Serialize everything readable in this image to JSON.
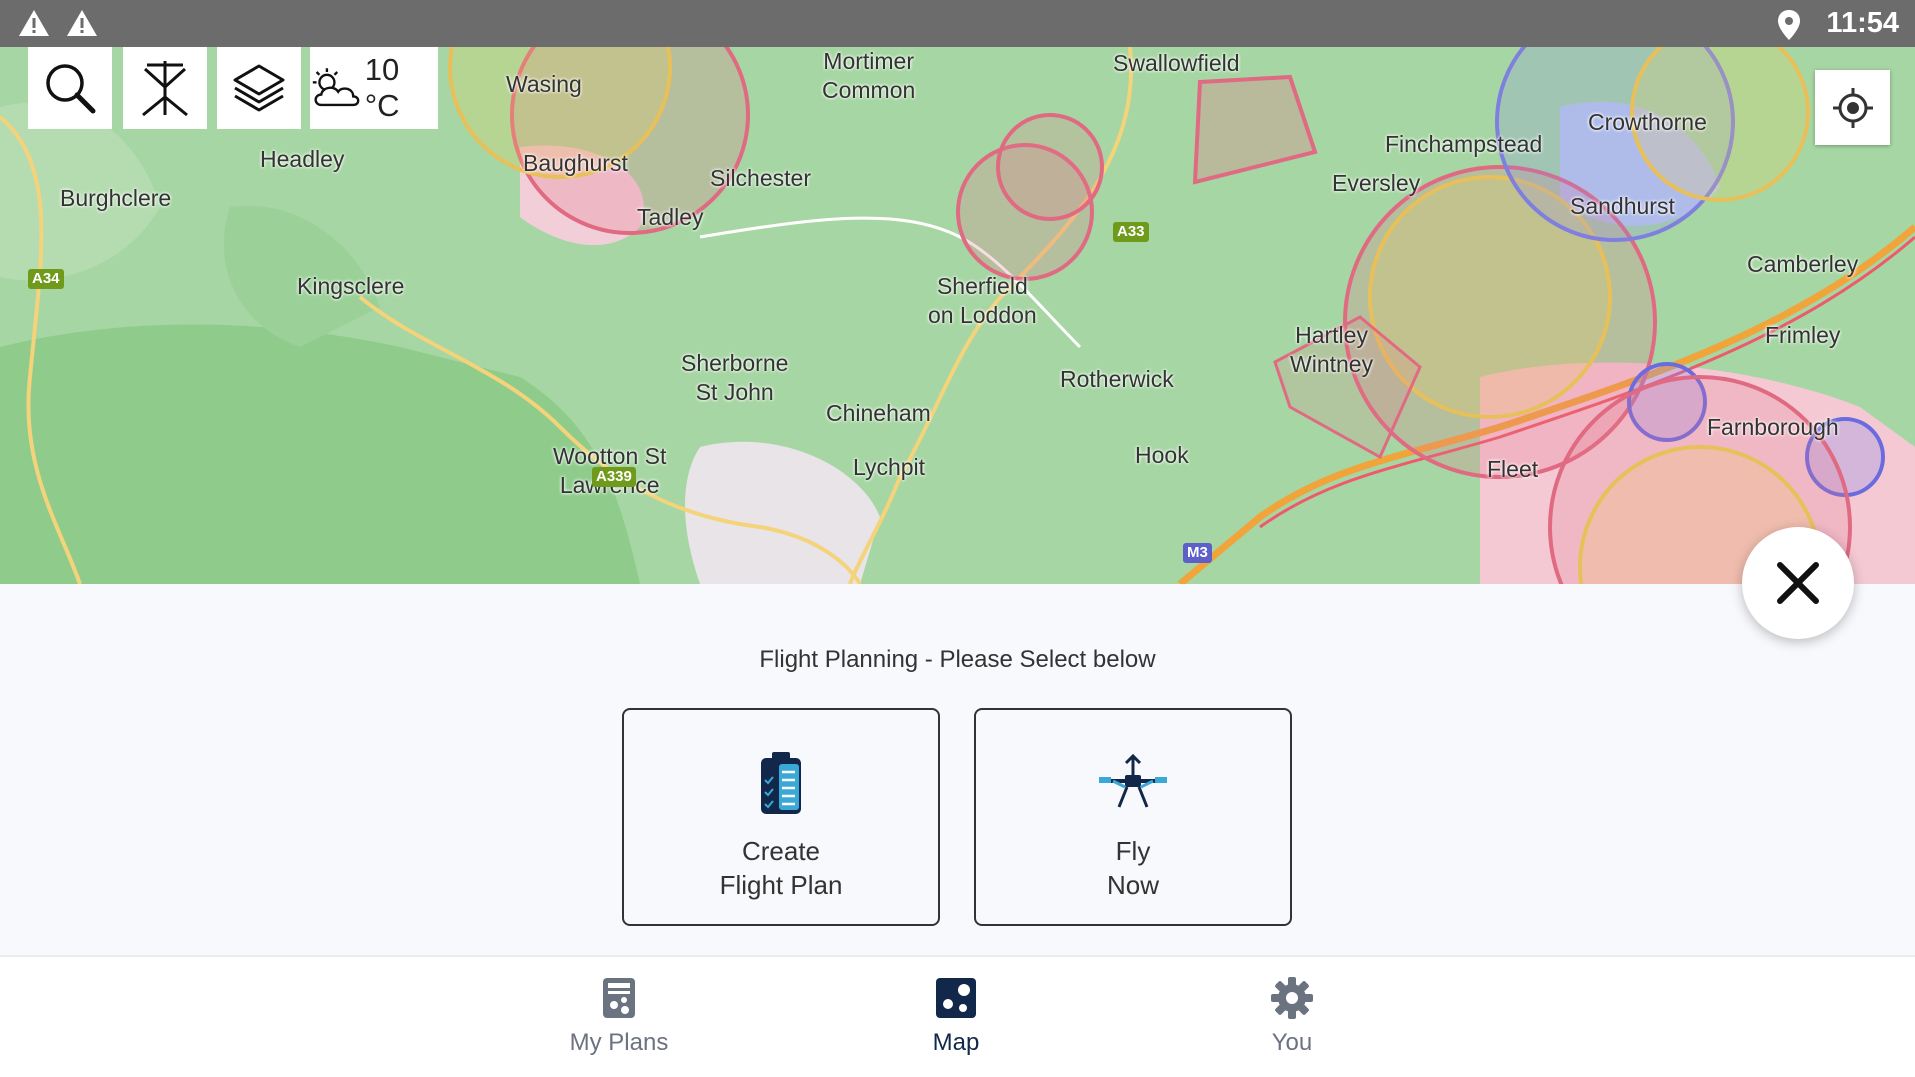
{
  "status_bar": {
    "time": "11:54"
  },
  "toolbar": {
    "temperature": "10 °C"
  },
  "map": {
    "places": [
      {
        "name": "Wasing"
      },
      {
        "name": "Mortimer\nCommon"
      },
      {
        "name": "Swallowfield"
      },
      {
        "name": "Headley"
      },
      {
        "name": "Baughurst"
      },
      {
        "name": "Silchester"
      },
      {
        "name": "Finchampstead"
      },
      {
        "name": "Crowthorne"
      },
      {
        "name": "Burghclere"
      },
      {
        "name": "Tadley"
      },
      {
        "name": "Eversley"
      },
      {
        "name": "Sandhurst"
      },
      {
        "name": "Camberley"
      },
      {
        "name": "Kingsclere"
      },
      {
        "name": "Sherfield\non Loddon"
      },
      {
        "name": "Frimley"
      },
      {
        "name": "Hartley\nWintney"
      },
      {
        "name": "Rotherwick"
      },
      {
        "name": "Sherborne\nSt John"
      },
      {
        "name": "Chineham"
      },
      {
        "name": "Farnborough"
      },
      {
        "name": "Hook"
      },
      {
        "name": "Wootton St\nLawrence"
      },
      {
        "name": "Lychpit"
      },
      {
        "name": "Fleet"
      }
    ],
    "roads": [
      "A33",
      "A34",
      "A339",
      "M3"
    ]
  },
  "panel": {
    "title": "Flight Planning - Please Select below"
  },
  "cards": [
    {
      "label": "Create\nFlight Plan",
      "icon": "clipboard-checklist-icon"
    },
    {
      "label": "Fly\nNow",
      "icon": "drone-icon"
    }
  ],
  "nav": [
    {
      "label": "My Plans",
      "icon": "plans-icon"
    },
    {
      "label": "Map",
      "icon": "map-icon"
    },
    {
      "label": "You",
      "icon": "gear-icon"
    }
  ],
  "colors": {
    "nav_active": "#12284b",
    "nav_inactive": "#6b7280",
    "map_green": "#a6d6a3"
  }
}
